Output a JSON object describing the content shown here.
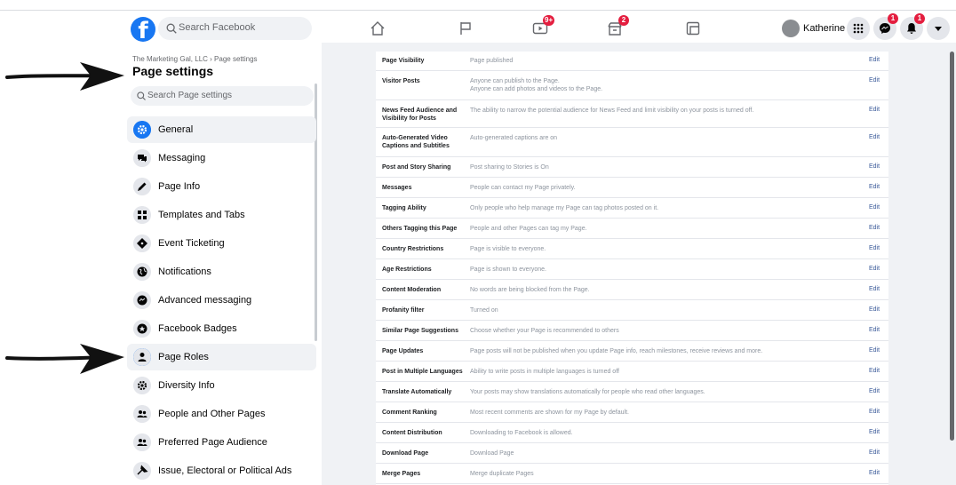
{
  "topbar": {
    "search_placeholder": "Search Facebook",
    "profile_name": "Katherine",
    "badges": {
      "watch": "9+",
      "marketplace": "2",
      "messenger": "1",
      "notifications": "1"
    }
  },
  "sidebar": {
    "breadcrumb": "The Marketing Gal, LLC › Page settings",
    "title": "Page settings",
    "search_placeholder": "Search Page settings",
    "items": [
      {
        "label": "General",
        "icon": "gear-icon"
      },
      {
        "label": "Messaging",
        "icon": "chat-bubbles-icon"
      },
      {
        "label": "Page Info",
        "icon": "pencil-icon"
      },
      {
        "label": "Templates and Tabs",
        "icon": "grid-icon"
      },
      {
        "label": "Event Ticketing",
        "icon": "ticket-icon"
      },
      {
        "label": "Notifications",
        "icon": "globe-icon"
      },
      {
        "label": "Advanced messaging",
        "icon": "messenger-icon"
      },
      {
        "label": "Facebook Badges",
        "icon": "badge-icon"
      },
      {
        "label": "Page Roles",
        "icon": "person-icon"
      },
      {
        "label": "Diversity Info",
        "icon": "gear-icon"
      },
      {
        "label": "People and Other Pages",
        "icon": "people-icon"
      },
      {
        "label": "Preferred Page Audience",
        "icon": "people-icon"
      },
      {
        "label": "Issue, Electoral or Political Ads",
        "icon": "megaphone-icon"
      }
    ]
  },
  "settings": {
    "edit_label": "Edit",
    "rows": [
      {
        "name": "Page Visibility",
        "desc": "Page published"
      },
      {
        "name": "Visitor Posts",
        "desc": "Anyone can publish to the Page.",
        "desc2": "Anyone can add photos and videos to the Page."
      },
      {
        "name": "News Feed Audience and Visibility for Posts",
        "desc": "The ability to narrow the potential audience for News Feed and limit visibility on your posts is turned off."
      },
      {
        "name": "Auto-Generated Video Captions and Subtitles",
        "desc": "Auto-generated captions are on"
      },
      {
        "name": "Post and Story Sharing",
        "desc": "Post sharing to Stories is On"
      },
      {
        "name": "Messages",
        "desc": "People can contact my Page privately."
      },
      {
        "name": "Tagging Ability",
        "desc": "Only people who help manage my Page can tag photos posted on it."
      },
      {
        "name": "Others Tagging this Page",
        "desc": "People and other Pages can tag my Page."
      },
      {
        "name": "Country Restrictions",
        "desc": "Page is visible to everyone."
      },
      {
        "name": "Age Restrictions",
        "desc": "Page is shown to everyone."
      },
      {
        "name": "Content Moderation",
        "desc": "No words are being blocked from the Page."
      },
      {
        "name": "Profanity filter",
        "desc": "Turned on"
      },
      {
        "name": "Similar Page Suggestions",
        "desc": "Choose whether your Page is recommended to others"
      },
      {
        "name": "Page Updates",
        "desc": "Page posts will not be published when you update Page info, reach milestones, receive reviews and more."
      },
      {
        "name": "Post in Multiple Languages",
        "desc": "Ability to write posts in multiple languages is turned off"
      },
      {
        "name": "Translate Automatically",
        "desc": "Your posts may show translations automatically for people who read other languages."
      },
      {
        "name": "Comment Ranking",
        "desc": "Most recent comments are shown for my Page by default."
      },
      {
        "name": "Content Distribution",
        "desc": "Downloading to Facebook is allowed."
      },
      {
        "name": "Download Page",
        "desc": "Download Page"
      },
      {
        "name": "Merge Pages",
        "desc": "Merge duplicate Pages"
      }
    ]
  },
  "colors": {
    "brand": "#1877f2",
    "badge": "#e41e3f",
    "link": "#385898"
  }
}
